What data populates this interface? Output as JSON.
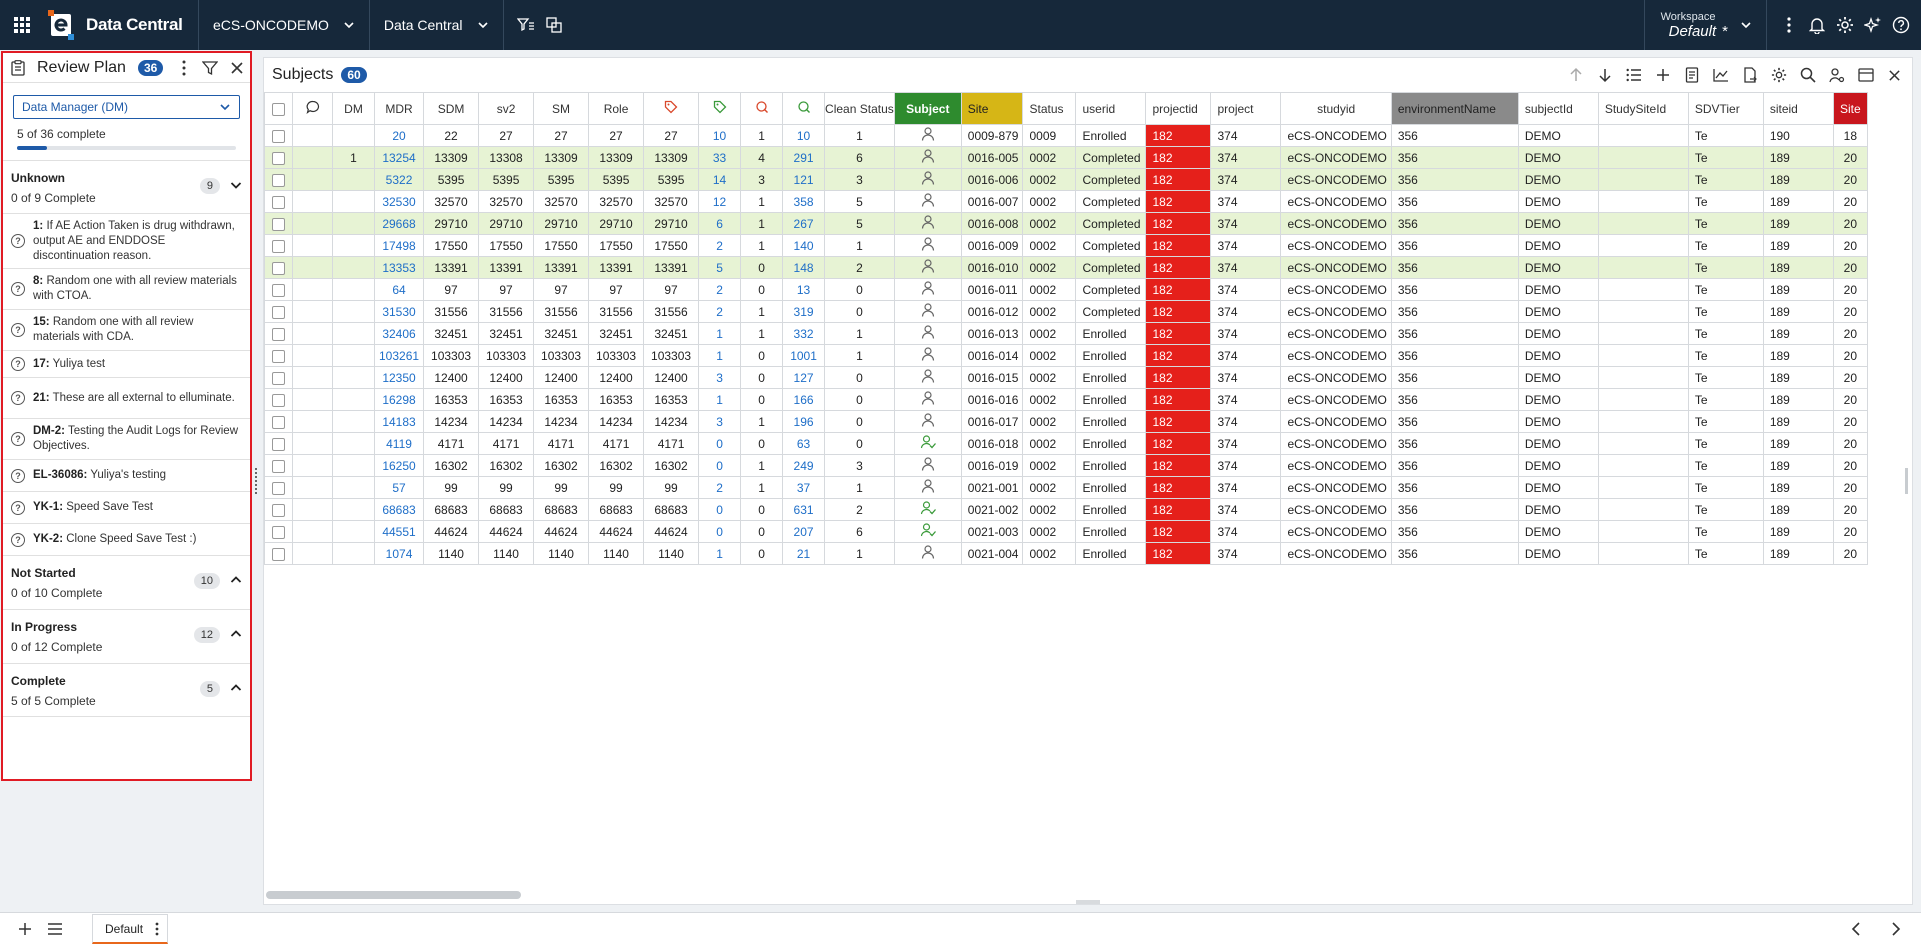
{
  "topbar": {
    "brand": "Data Central",
    "study": "eCS-ONCODEMO",
    "app": "Data Central",
    "workspace_label": "Workspace",
    "workspace_value": "Default",
    "workspace_mark": "*"
  },
  "panel": {
    "title": "Review Plan",
    "count": "36",
    "role": "Data Manager (DM)",
    "complete_text": "5 of 36 complete",
    "progress": 0.139,
    "groups": [
      {
        "title": "Unknown",
        "sub": "0 of 9 Complete",
        "count": "9",
        "expanded": true
      },
      {
        "title": "Not Started",
        "sub": "0 of 10 Complete",
        "count": "10",
        "expanded": false
      },
      {
        "title": "In Progress",
        "sub": "0 of 12 Complete",
        "count": "12",
        "expanded": false
      },
      {
        "title": "Complete",
        "sub": "5 of 5 Complete",
        "count": "5",
        "expanded": false
      }
    ],
    "items": [
      {
        "id": "1:",
        "text": "If AE Action Taken is drug withdrawn, output AE and ENDDOSE discontinuation reason."
      },
      {
        "id": "8:",
        "text": "Random one with all review materials with CTOA."
      },
      {
        "id": "15:",
        "text": "Random one with all review materials with CDA."
      },
      {
        "id": "17:",
        "text": "Yuliya test"
      },
      {
        "id": "21:",
        "text": "These are all external to elluminate."
      },
      {
        "id": "DM-2:",
        "text": "Testing the Audit Logs for Review Objectives."
      },
      {
        "id": "EL-36086:",
        "text": "Yuliya's testing"
      },
      {
        "id": "YK-1:",
        "text": "Speed Save Test"
      },
      {
        "id": "YK-2:",
        "text": "Clone Speed Save Test :)"
      }
    ]
  },
  "main": {
    "title": "Subjects",
    "count": "60",
    "columns": [
      "",
      "",
      "DM",
      "MDR",
      "SDM",
      "sv2",
      "SM",
      "Role",
      "",
      "",
      "",
      "",
      "Clean Status",
      "Subject",
      "Site",
      "Status",
      "userid",
      "projectid",
      "project",
      "studyid",
      "environmentName",
      "subjectId",
      "StudySiteId",
      "SDVTier",
      "siteid",
      "Site"
    ],
    "rows": [
      {
        "dm": "",
        "mdr": "20",
        "sdm": "22",
        "sv2": "27",
        "sm": "27",
        "role": "27",
        "t1": "27",
        "t2": "10",
        "q1": "1",
        "q2": "10",
        "clean": "1",
        "subj_ok": false,
        "site": "0009-879",
        "status": "0009",
        "userid": "Enrolled",
        "projectid": "182",
        "project": "374",
        "studyid": "eCS-ONCODEMO",
        "env": "356",
        "subjectId": "DEMO",
        "studysite": "",
        "sdv": "Te",
        "siteid": "190",
        "site2": "18",
        "hl": false
      },
      {
        "dm": "1",
        "mdr": "13254",
        "sdm": "13309",
        "sv2": "13308",
        "sm": "13309",
        "role": "13309",
        "t1": "13309",
        "t2": "33",
        "q1": "4",
        "q2": "291",
        "clean": "6",
        "subj_ok": false,
        "site": "0016-005",
        "status": "0002",
        "userid": "Completed",
        "projectid": "182",
        "project": "374",
        "studyid": "eCS-ONCODEMO",
        "env": "356",
        "subjectId": "DEMO",
        "studysite": "",
        "sdv": "Te",
        "siteid": "189",
        "site2": "20",
        "hl": true
      },
      {
        "dm": "",
        "mdr": "5322",
        "sdm": "5395",
        "sv2": "5395",
        "sm": "5395",
        "role": "5395",
        "t1": "5395",
        "t2": "14",
        "q1": "3",
        "q2": "121",
        "clean": "3",
        "subj_ok": false,
        "site": "0016-006",
        "status": "0002",
        "userid": "Completed",
        "projectid": "182",
        "project": "374",
        "studyid": "eCS-ONCODEMO",
        "env": "356",
        "subjectId": "DEMO",
        "studysite": "",
        "sdv": "Te",
        "siteid": "189",
        "site2": "20",
        "hl": true
      },
      {
        "dm": "",
        "mdr": "32530",
        "sdm": "32570",
        "sv2": "32570",
        "sm": "32570",
        "role": "32570",
        "t1": "32570",
        "t2": "12",
        "q1": "1",
        "q2": "358",
        "clean": "5",
        "subj_ok": false,
        "site": "0016-007",
        "status": "0002",
        "userid": "Completed",
        "projectid": "182",
        "project": "374",
        "studyid": "eCS-ONCODEMO",
        "env": "356",
        "subjectId": "DEMO",
        "studysite": "",
        "sdv": "Te",
        "siteid": "189",
        "site2": "20",
        "hl": false
      },
      {
        "dm": "",
        "mdr": "29668",
        "sdm": "29710",
        "sv2": "29710",
        "sm": "29710",
        "role": "29710",
        "t1": "29710",
        "t2": "6",
        "q1": "1",
        "q2": "267",
        "clean": "5",
        "subj_ok": false,
        "site": "0016-008",
        "status": "0002",
        "userid": "Completed",
        "projectid": "182",
        "project": "374",
        "studyid": "eCS-ONCODEMO",
        "env": "356",
        "subjectId": "DEMO",
        "studysite": "",
        "sdv": "Te",
        "siteid": "189",
        "site2": "20",
        "hl": true
      },
      {
        "dm": "",
        "mdr": "17498",
        "sdm": "17550",
        "sv2": "17550",
        "sm": "17550",
        "role": "17550",
        "t1": "17550",
        "t2": "2",
        "q1": "1",
        "q2": "140",
        "clean": "1",
        "subj_ok": false,
        "site": "0016-009",
        "status": "0002",
        "userid": "Completed",
        "projectid": "182",
        "project": "374",
        "studyid": "eCS-ONCODEMO",
        "env": "356",
        "subjectId": "DEMO",
        "studysite": "",
        "sdv": "Te",
        "siteid": "189",
        "site2": "20",
        "hl": false
      },
      {
        "dm": "",
        "mdr": "13353",
        "sdm": "13391",
        "sv2": "13391",
        "sm": "13391",
        "role": "13391",
        "t1": "13391",
        "t2": "5",
        "q1": "0",
        "q2": "148",
        "clean": "2",
        "subj_ok": false,
        "site": "0016-010",
        "status": "0002",
        "userid": "Completed",
        "projectid": "182",
        "project": "374",
        "studyid": "eCS-ONCODEMO",
        "env": "356",
        "subjectId": "DEMO",
        "studysite": "",
        "sdv": "Te",
        "siteid": "189",
        "site2": "20",
        "hl": true
      },
      {
        "dm": "",
        "mdr": "64",
        "sdm": "97",
        "sv2": "97",
        "sm": "97",
        "role": "97",
        "t1": "97",
        "t2": "2",
        "q1": "0",
        "q2": "13",
        "clean": "0",
        "subj_ok": false,
        "site": "0016-011",
        "status": "0002",
        "userid": "Completed",
        "projectid": "182",
        "project": "374",
        "studyid": "eCS-ONCODEMO",
        "env": "356",
        "subjectId": "DEMO",
        "studysite": "",
        "sdv": "Te",
        "siteid": "189",
        "site2": "20",
        "hl": false
      },
      {
        "dm": "",
        "mdr": "31530",
        "sdm": "31556",
        "sv2": "31556",
        "sm": "31556",
        "role": "31556",
        "t1": "31556",
        "t2": "2",
        "q1": "1",
        "q2": "319",
        "clean": "0",
        "subj_ok": false,
        "site": "0016-012",
        "status": "0002",
        "userid": "Completed",
        "projectid": "182",
        "project": "374",
        "studyid": "eCS-ONCODEMO",
        "env": "356",
        "subjectId": "DEMO",
        "studysite": "",
        "sdv": "Te",
        "siteid": "189",
        "site2": "20",
        "hl": false
      },
      {
        "dm": "",
        "mdr": "32406",
        "sdm": "32451",
        "sv2": "32451",
        "sm": "32451",
        "role": "32451",
        "t1": "32451",
        "t2": "1",
        "q1": "1",
        "q2": "332",
        "clean": "1",
        "subj_ok": false,
        "site": "0016-013",
        "status": "0002",
        "userid": "Enrolled",
        "projectid": "182",
        "project": "374",
        "studyid": "eCS-ONCODEMO",
        "env": "356",
        "subjectId": "DEMO",
        "studysite": "",
        "sdv": "Te",
        "siteid": "189",
        "site2": "20",
        "hl": false
      },
      {
        "dm": "",
        "mdr": "103261",
        "sdm": "103303",
        "sv2": "103303",
        "sm": "103303",
        "role": "103303",
        "t1": "103303",
        "t2": "1",
        "q1": "0",
        "q2": "1001",
        "clean": "1",
        "subj_ok": false,
        "site": "0016-014",
        "status": "0002",
        "userid": "Enrolled",
        "projectid": "182",
        "project": "374",
        "studyid": "eCS-ONCODEMO",
        "env": "356",
        "subjectId": "DEMO",
        "studysite": "",
        "sdv": "Te",
        "siteid": "189",
        "site2": "20",
        "hl": false
      },
      {
        "dm": "",
        "mdr": "12350",
        "sdm": "12400",
        "sv2": "12400",
        "sm": "12400",
        "role": "12400",
        "t1": "12400",
        "t2": "3",
        "q1": "0",
        "q2": "127",
        "clean": "0",
        "subj_ok": false,
        "site": "0016-015",
        "status": "0002",
        "userid": "Enrolled",
        "projectid": "182",
        "project": "374",
        "studyid": "eCS-ONCODEMO",
        "env": "356",
        "subjectId": "DEMO",
        "studysite": "",
        "sdv": "Te",
        "siteid": "189",
        "site2": "20",
        "hl": false
      },
      {
        "dm": "",
        "mdr": "16298",
        "sdm": "16353",
        "sv2": "16353",
        "sm": "16353",
        "role": "16353",
        "t1": "16353",
        "t2": "1",
        "q1": "0",
        "q2": "166",
        "clean": "0",
        "subj_ok": false,
        "site": "0016-016",
        "status": "0002",
        "userid": "Enrolled",
        "projectid": "182",
        "project": "374",
        "studyid": "eCS-ONCODEMO",
        "env": "356",
        "subjectId": "DEMO",
        "studysite": "",
        "sdv": "Te",
        "siteid": "189",
        "site2": "20",
        "hl": false
      },
      {
        "dm": "",
        "mdr": "14183",
        "sdm": "14234",
        "sv2": "14234",
        "sm": "14234",
        "role": "14234",
        "t1": "14234",
        "t2": "3",
        "q1": "1",
        "q2": "196",
        "clean": "0",
        "subj_ok": false,
        "site": "0016-017",
        "status": "0002",
        "userid": "Enrolled",
        "projectid": "182",
        "project": "374",
        "studyid": "eCS-ONCODEMO",
        "env": "356",
        "subjectId": "DEMO",
        "studysite": "",
        "sdv": "Te",
        "siteid": "189",
        "site2": "20",
        "hl": false
      },
      {
        "dm": "",
        "mdr": "4119",
        "sdm": "4171",
        "sv2": "4171",
        "sm": "4171",
        "role": "4171",
        "t1": "4171",
        "t2": "0",
        "q1": "0",
        "q2": "63",
        "clean": "0",
        "subj_ok": true,
        "site": "0016-018",
        "status": "0002",
        "userid": "Enrolled",
        "projectid": "182",
        "project": "374",
        "studyid": "eCS-ONCODEMO",
        "env": "356",
        "subjectId": "DEMO",
        "studysite": "",
        "sdv": "Te",
        "siteid": "189",
        "site2": "20",
        "hl": false
      },
      {
        "dm": "",
        "mdr": "16250",
        "sdm": "16302",
        "sv2": "16302",
        "sm": "16302",
        "role": "16302",
        "t1": "16302",
        "t2": "0",
        "q1": "1",
        "q2": "249",
        "clean": "3",
        "subj_ok": false,
        "site": "0016-019",
        "status": "0002",
        "userid": "Enrolled",
        "projectid": "182",
        "project": "374",
        "studyid": "eCS-ONCODEMO",
        "env": "356",
        "subjectId": "DEMO",
        "studysite": "",
        "sdv": "Te",
        "siteid": "189",
        "site2": "20",
        "hl": false
      },
      {
        "dm": "",
        "mdr": "57",
        "sdm": "99",
        "sv2": "99",
        "sm": "99",
        "role": "99",
        "t1": "99",
        "t2": "2",
        "q1": "1",
        "q2": "37",
        "clean": "1",
        "subj_ok": false,
        "site": "0021-001",
        "status": "0002",
        "userid": "Enrolled",
        "projectid": "182",
        "project": "374",
        "studyid": "eCS-ONCODEMO",
        "env": "356",
        "subjectId": "DEMO",
        "studysite": "",
        "sdv": "Te",
        "siteid": "189",
        "site2": "20",
        "hl": false
      },
      {
        "dm": "",
        "mdr": "68683",
        "sdm": "68683",
        "sv2": "68683",
        "sm": "68683",
        "role": "68683",
        "t1": "68683",
        "t2": "0",
        "q1": "0",
        "q2": "631",
        "clean": "2",
        "subj_ok": true,
        "site": "0021-002",
        "status": "0002",
        "userid": "Enrolled",
        "projectid": "182",
        "project": "374",
        "studyid": "eCS-ONCODEMO",
        "env": "356",
        "subjectId": "DEMO",
        "studysite": "",
        "sdv": "Te",
        "siteid": "189",
        "site2": "20",
        "hl": false
      },
      {
        "dm": "",
        "mdr": "44551",
        "sdm": "44624",
        "sv2": "44624",
        "sm": "44624",
        "role": "44624",
        "t1": "44624",
        "t2": "0",
        "q1": "0",
        "q2": "207",
        "clean": "6",
        "subj_ok": true,
        "site": "0021-003",
        "status": "0002",
        "userid": "Enrolled",
        "projectid": "182",
        "project": "374",
        "studyid": "eCS-ONCODEMO",
        "env": "356",
        "subjectId": "DEMO",
        "studysite": "",
        "sdv": "Te",
        "siteid": "189",
        "site2": "20",
        "hl": false
      },
      {
        "dm": "",
        "mdr": "1074",
        "sdm": "1140",
        "sv2": "1140",
        "sm": "1140",
        "role": "1140",
        "t1": "1140",
        "t2": "1",
        "q1": "0",
        "q2": "21",
        "clean": "1",
        "subj_ok": false,
        "site": "0021-004",
        "status": "0002",
        "userid": "Enrolled",
        "projectid": "182",
        "project": "374",
        "studyid": "eCS-ONCODEMO",
        "env": "356",
        "subjectId": "DEMO",
        "studysite": "",
        "sdv": "Te",
        "siteid": "189",
        "site2": "20",
        "hl": false
      }
    ]
  },
  "bottombar": {
    "tab_label": "Default"
  },
  "colors": {
    "topbar": "#16283a",
    "accent": "#1e5aa8",
    "link": "#1e6ec8",
    "highlight_row": "#e7f3d4",
    "red_cell": "#e5201b",
    "subject_header": "#2e8b2e",
    "site_header": "#d6b616",
    "env_header": "#8a8a8a",
    "site2_header": "#c8161d",
    "tab_underline": "#e8671b"
  }
}
